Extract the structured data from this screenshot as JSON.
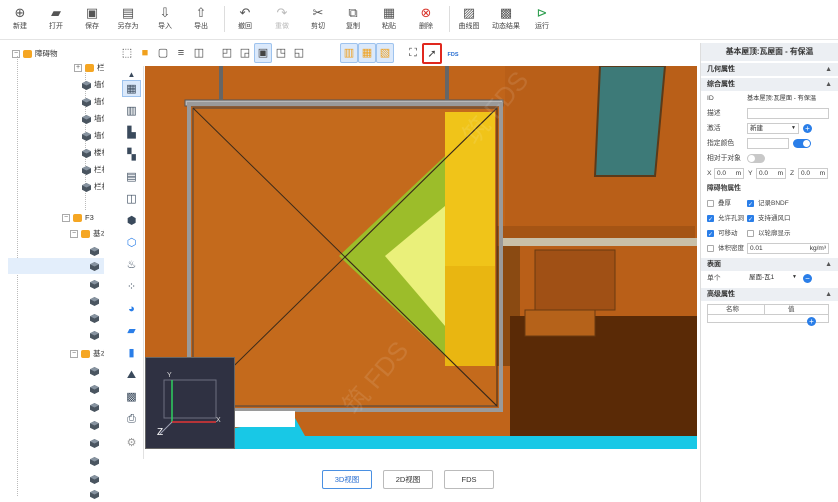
{
  "toolbar": {
    "new": "新建",
    "open": "打开",
    "save": "保存",
    "save_as": "另存为",
    "import": "导入",
    "export": "导出",
    "undo": "撤回",
    "redo": "重做",
    "cut": "剪切",
    "copy": "复制",
    "paste": "粘贴",
    "delete": "删除",
    "curve": "曲线图",
    "animation": "动态结果",
    "run": "运行"
  },
  "tree": {
    "root": "障碍物",
    "items": [
      "栏杆",
      "墙体",
      "墙体",
      "墙体",
      "墙体",
      "楼梯",
      "栏杆",
      "栏杆"
    ],
    "floor": "F3",
    "group1": "基本屋顶",
    "group2": "基本屋顶"
  },
  "view_tabs": {
    "tab3d": "3D视图",
    "tab2d": "2D视图",
    "tabfds": "FDS"
  },
  "toolbar_view": {
    "fds_label": "FDS"
  },
  "axes": {
    "x": "X",
    "y": "Y",
    "z": "Z"
  },
  "props": {
    "title": "基本屋顶:瓦屋面 - 有保温",
    "geometry": "几何属性",
    "general": "综合属性",
    "id_label": "ID",
    "id_value": "基本屋顶:瓦屋面 - 有保温",
    "desc_label": "描述",
    "activate_label": "激活",
    "activate_value": "新建",
    "color_label": "指定颜色",
    "relative_label": "相对于对象",
    "x_label": "X",
    "x_value": "0.0",
    "y_label": "Y",
    "y_value": "0.0",
    "z_label": "Z",
    "z_value": "0.0",
    "unit_m": "m",
    "obstacle": "障碍物属性",
    "overlap": "叠厚",
    "record_bndf": "记录BNDF",
    "allow_hole": "允许孔洞",
    "support_vent": "支持通风口",
    "movable": "可移动",
    "show_outline": "以轮廓显示",
    "bulk_density_label": "体积密度",
    "bulk_density_value": "0.01",
    "bulk_density_unit": "kg/m³",
    "surface": "表面",
    "single_label": "单个",
    "single_value": "屋面-瓦1",
    "advanced": "高级属性",
    "col_name": "名称",
    "col_value": "值"
  },
  "colors": {
    "accent": "#2a7ee8",
    "roof": "#c0641a",
    "highlight_box": "#e0281e"
  }
}
